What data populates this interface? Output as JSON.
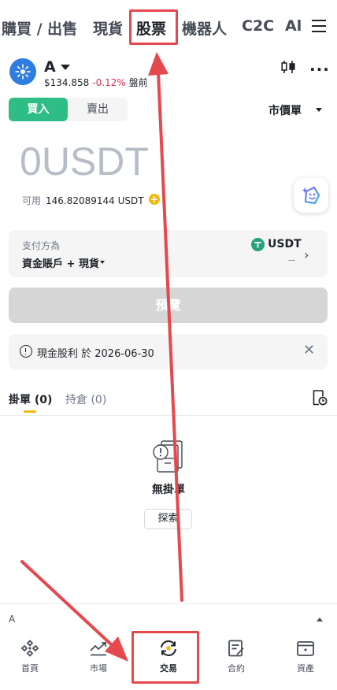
{
  "top_tabs": [
    {
      "label": "購買 / 出售",
      "active": false
    },
    {
      "label": "現貨",
      "active": false
    },
    {
      "label": "股票",
      "active": true
    },
    {
      "label": "機器人",
      "active": false
    },
    {
      "label": "C2C",
      "active": false
    },
    {
      "label": "Al",
      "active": false
    }
  ],
  "asset": {
    "symbol": "A",
    "price": "$134.858",
    "change": "-0.12%",
    "session": "盤前"
  },
  "trade": {
    "buy_label": "買入",
    "sell_label": "賣出",
    "order_type": "市價單"
  },
  "amount": {
    "value": "0",
    "unit": "USDT"
  },
  "available": {
    "label": "可用",
    "value": "146.82089144 USDT"
  },
  "payment": {
    "label": "支付方為",
    "method": "資金賬戶 + 現貨",
    "coin": "USDT",
    "amount": "--"
  },
  "preview_button": "預覽",
  "notice": {
    "text": "現金股利 於 2026-06-30"
  },
  "order_tabs": [
    {
      "label": "掛單 (0)",
      "active": true
    },
    {
      "label": "持倉 (0)",
      "active": false
    }
  ],
  "empty_state": {
    "text": "無掛單",
    "button": "探索"
  },
  "mini_bar": {
    "symbol": "A"
  },
  "bottom_nav": [
    {
      "label": "首頁",
      "icon": "home-icon",
      "active": false
    },
    {
      "label": "市場",
      "icon": "markets-icon",
      "active": false
    },
    {
      "label": "交易",
      "icon": "trade-icon",
      "active": true
    },
    {
      "label": "合約",
      "icon": "futures-icon",
      "active": false
    },
    {
      "label": "資產",
      "icon": "wallet-icon",
      "active": false
    }
  ],
  "colors": {
    "buy_green": "#2ebd85",
    "negative_red": "#d9304e",
    "accent_yellow": "#f0b90b",
    "annotation_red": "#e5484d",
    "usdt_green": "#26a17b"
  }
}
